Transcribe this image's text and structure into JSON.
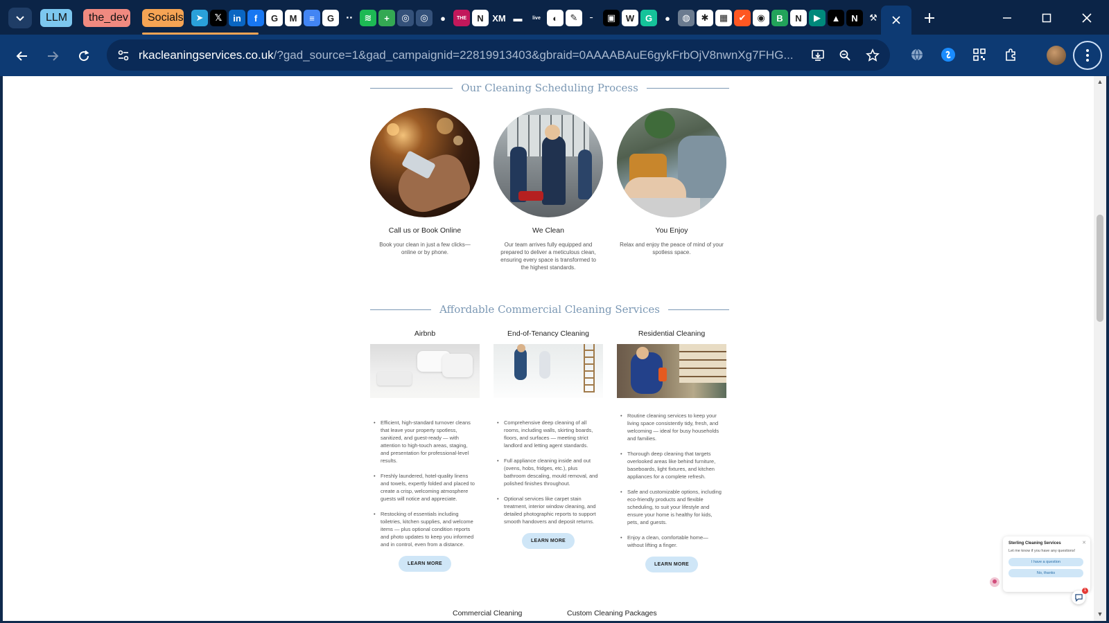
{
  "browser": {
    "tab_groups": [
      {
        "label": "LLM",
        "color": "#7cc7ef"
      },
      {
        "label": "the_dev",
        "color": "#f08a80"
      },
      {
        "label": "Socials",
        "color": "#f5a454"
      }
    ],
    "favicons": [
      {
        "icon": "telegram-icon",
        "glyph": "➤",
        "color": "#2aa0da"
      },
      {
        "icon": "x-icon",
        "glyph": "𝕏",
        "color": "#000000"
      },
      {
        "icon": "linkedin-icon",
        "glyph": "in",
        "color": "#0a66c2"
      },
      {
        "icon": "facebook-icon",
        "glyph": "f",
        "color": "#1877f2"
      },
      {
        "icon": "google-icon",
        "glyph": "G",
        "color": "#ffffff"
      },
      {
        "icon": "gmail-icon",
        "glyph": "M",
        "color": "#ffffff"
      },
      {
        "icon": "docs-icon",
        "glyph": "≡",
        "color": "#4285f4"
      },
      {
        "icon": "google-icon",
        "glyph": "G",
        "color": "#ffffff"
      },
      {
        "icon": "dots-icon",
        "glyph": "⋅⋅",
        "color": "#0b2447"
      },
      {
        "icon": "spotify-icon",
        "glyph": "≋",
        "color": "#1db954"
      },
      {
        "icon": "sheets-icon",
        "glyph": "+",
        "color": "#34a853"
      },
      {
        "icon": "globe-icon",
        "glyph": "◎",
        "color": "#34517a"
      },
      {
        "icon": "globe-icon",
        "glyph": "◎",
        "color": "#34517a"
      },
      {
        "icon": "github-icon",
        "glyph": "●",
        "color": "#0b2447"
      },
      {
        "icon": "the-icon",
        "glyph": "THE",
        "color": "#c2185b"
      },
      {
        "icon": "notion-icon",
        "glyph": "N",
        "color": "#ffffff"
      },
      {
        "icon": "xm-icon",
        "glyph": "XM",
        "color": "#0b2447"
      },
      {
        "icon": "bar-icon",
        "glyph": "▬",
        "color": "#0b2447"
      },
      {
        "icon": "live-icon",
        "glyph": "live",
        "color": "#0b2447"
      },
      {
        "icon": "chrome-icon",
        "glyph": "◐",
        "color": "#ffffff"
      },
      {
        "icon": "bolt-icon",
        "glyph": "✎",
        "color": "#ffffff"
      },
      {
        "icon": "dash-icon",
        "glyph": "╴",
        "color": "#0b2447"
      },
      {
        "icon": "cube-icon",
        "glyph": "▣",
        "color": "#000000"
      },
      {
        "icon": "wikipedia-icon",
        "glyph": "W",
        "color": "#ffffff"
      },
      {
        "icon": "grammarly-icon",
        "glyph": "G",
        "color": "#15c39a"
      },
      {
        "icon": "github-icon",
        "glyph": "●",
        "color": "#0b2447"
      },
      {
        "icon": "globe-icon",
        "glyph": "◍",
        "color": "#6b7b8f"
      },
      {
        "icon": "asterisk-icon",
        "glyph": "✱",
        "color": "#ffffff"
      },
      {
        "icon": "grid-icon",
        "glyph": "▦",
        "color": "#ffffff"
      },
      {
        "icon": "check-icon",
        "glyph": "✔",
        "color": "#ff5722"
      },
      {
        "icon": "ring-icon",
        "glyph": "◉",
        "color": "#ffffff"
      },
      {
        "icon": "b-icon",
        "glyph": "B",
        "color": "#22a35a"
      },
      {
        "icon": "notion-icon",
        "glyph": "N",
        "color": "#ffffff"
      },
      {
        "icon": "meet-icon",
        "glyph": "▶",
        "color": "#00897b"
      },
      {
        "icon": "triangle-icon",
        "glyph": "▲",
        "color": "#000000"
      },
      {
        "icon": "n-icon",
        "glyph": "N",
        "color": "#000000"
      },
      {
        "icon": "tools-icon",
        "glyph": "⚒",
        "color": "#0b2447"
      }
    ],
    "window_controls": {
      "minimize": "—",
      "maximize": "☐",
      "close": "✕"
    },
    "address": {
      "domain": "rkacleaningservices.co.uk",
      "rest": "/?gad_source=1&gad_campaignid=22819913403&gbraid=0AAAABAuE6gykFrbOjV8nwnXg7FHG..."
    }
  },
  "page": {
    "process": {
      "title": "Our Cleaning Scheduling Process",
      "steps": [
        {
          "heading": "Call us or Book Online",
          "text": "Book your clean in just a few clicks—online or by phone."
        },
        {
          "heading": "We Clean",
          "text": "Our team arrives fully equipped and prepared to deliver a meticulous clean, ensuring every space is transformed to the highest standards."
        },
        {
          "heading": "You Enjoy",
          "text": "Relax and enjoy the peace of mind of your spotless space."
        }
      ]
    },
    "services": {
      "title": "Affordable Commercial Cleaning Services",
      "items": [
        {
          "heading": "Airbnb",
          "bullets": [
            "Efficient, high-standard turnover cleans that leave your property spotless, sanitized, and guest-ready — with attention to high-touch areas, staging, and presentation for professional-level results.",
            "Freshly laundered, hotel-quality linens and towels, expertly folded and placed to create a crisp, welcoming atmosphere guests will notice and appreciate.",
            "Restocking of essentials including toiletries, kitchen supplies, and welcome items — plus optional condition reports and photo updates to keep you informed and in control, even from a distance."
          ],
          "button": "LEARN MORE"
        },
        {
          "heading": "End-of-Tenancy Cleaning",
          "bullets": [
            "Comprehensive deep cleaning of all rooms, including walls, skirting boards, floors, and surfaces — meeting strict landlord and letting agent standards.",
            "Full appliance cleaning inside and out (ovens, hobs, fridges, etc.), plus bathroom descaling, mould removal, and polished finishes throughout.",
            "Optional services like carpet stain treatment, interior window cleaning, and detailed photographic reports to support smooth handovers and deposit returns."
          ],
          "button": "LEARN MORE"
        },
        {
          "heading": "Residential Cleaning",
          "bullets": [
            "Routine cleaning services to keep your living space consistently tidy, fresh, and welcoming — ideal for busy households and families.",
            "Thorough deep cleaning that targets overlooked areas like behind furniture, baseboards, light fixtures, and kitchen appliances for a complete refresh.",
            "Safe and customizable options, including eco-friendly products and flexible scheduling, to suit your lifestyle and ensure your home is healthy for kids, pets, and guests.",
            "Enjoy a clean, comfortable home—without lifting a finger."
          ],
          "button": "LEARN MORE"
        }
      ]
    },
    "footer_links": [
      "Commercial Cleaning",
      "Custom Cleaning Packages"
    ]
  },
  "chat": {
    "title": "Sterling Cleaning Services",
    "message": "Let me know if you have any questions!",
    "option_1": "I have a question",
    "option_2": "No, thanks",
    "close": "✕",
    "badge": "1"
  }
}
